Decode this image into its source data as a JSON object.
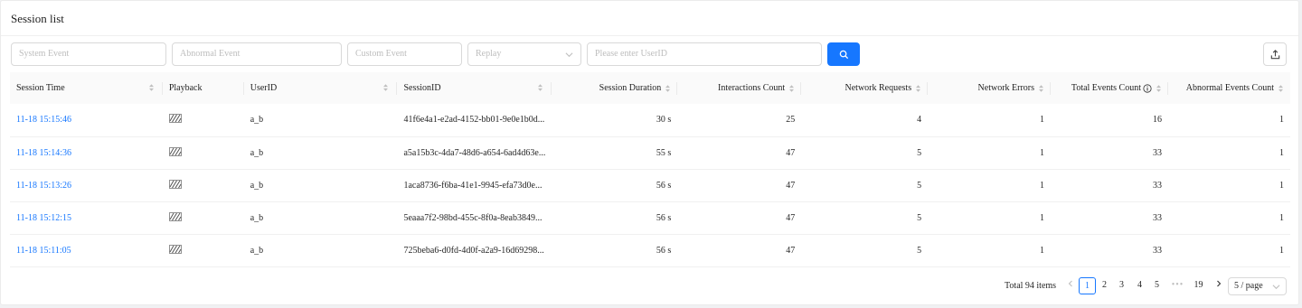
{
  "panel": {
    "title": "Session list"
  },
  "filters": {
    "system_event": "System Event",
    "abnormal_event": "Abnormal Event",
    "custom_event": "Custom Event",
    "replay": "Replay",
    "userid_placeholder": "Please enter UserID"
  },
  "icons": {
    "search": "search-icon",
    "export": "export-icon",
    "playback": "playback-icon",
    "info": "info-icon"
  },
  "colors": {
    "primary": "#1677ff",
    "link": "#1677ff"
  },
  "table": {
    "columns": [
      "Session Time",
      "Playback",
      "UserID",
      "SessionID",
      "Session Duration",
      "Interactions Count",
      "Network Requests",
      "Network Errors",
      "Total Events Count",
      "Abnormal Events Count"
    ],
    "rows": [
      {
        "time": "11-18 15:15:46",
        "user": "a_b",
        "session": "41f6e4a1-e2ad-4152-bb01-9e0e1b0d...",
        "duration": "30 s",
        "interactions": "25",
        "requests": "4",
        "errors": "1",
        "total": "16",
        "abnormal": "1"
      },
      {
        "time": "11-18 15:14:36",
        "user": "a_b",
        "session": "a5a15b3c-4da7-48d6-a654-6ad4d63e...",
        "duration": "55 s",
        "interactions": "47",
        "requests": "5",
        "errors": "1",
        "total": "33",
        "abnormal": "1"
      },
      {
        "time": "11-18 15:13:26",
        "user": "a_b",
        "session": "1aca8736-f6ba-41e1-9945-efa73d0e...",
        "duration": "56 s",
        "interactions": "47",
        "requests": "5",
        "errors": "1",
        "total": "33",
        "abnormal": "1"
      },
      {
        "time": "11-18 15:12:15",
        "user": "a_b",
        "session": "5eaaa7f2-98bd-455c-8f0a-8eab3849...",
        "duration": "56 s",
        "interactions": "47",
        "requests": "5",
        "errors": "1",
        "total": "33",
        "abnormal": "1"
      },
      {
        "time": "11-18 15:11:05",
        "user": "a_b",
        "session": "725beba6-d0fd-4d0f-a2a9-16d69298...",
        "duration": "56 s",
        "interactions": "47",
        "requests": "5",
        "errors": "1",
        "total": "33",
        "abnormal": "1"
      }
    ]
  },
  "pagination": {
    "total": "Total 94 items",
    "pages": [
      "1",
      "2",
      "3",
      "4",
      "5"
    ],
    "ellipsis": "•••",
    "last": "19",
    "current": "1",
    "page_size": "5 / page"
  }
}
